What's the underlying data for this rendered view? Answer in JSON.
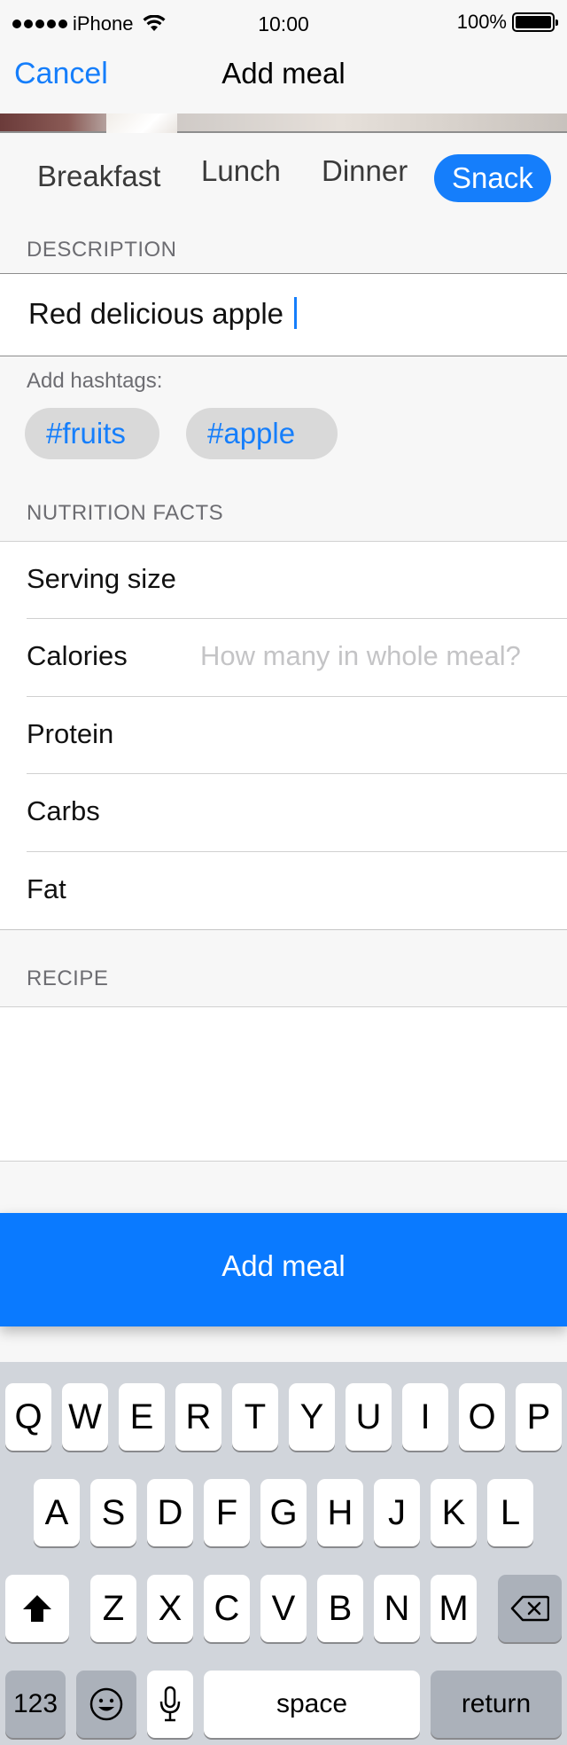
{
  "status_bar": {
    "carrier": "iPhone",
    "time": "10:00",
    "battery": "100%"
  },
  "nav": {
    "cancel_label": "Cancel",
    "title": "Add meal"
  },
  "meal_types": {
    "items": [
      "Breakfast",
      "Lunch",
      "Dinner",
      "Snack"
    ],
    "selected": "Snack"
  },
  "description": {
    "header": "DESCRIPTION",
    "value": "Red delicious apple"
  },
  "hashtags": {
    "label": "Add hashtags:",
    "items": [
      "#fruits",
      "#apple"
    ]
  },
  "nutrition": {
    "header": "NUTRITION FACTS",
    "rows": [
      {
        "label": "Serving size",
        "placeholder": ""
      },
      {
        "label": "Calories",
        "placeholder": "How many in whole meal?"
      },
      {
        "label": "Protein",
        "placeholder": ""
      },
      {
        "label": "Carbs",
        "placeholder": ""
      },
      {
        "label": "Fat",
        "placeholder": ""
      }
    ]
  },
  "recipe": {
    "header": "RECIPE"
  },
  "add_button_label": "Add meal",
  "keyboard": {
    "row1": [
      "Q",
      "W",
      "E",
      "R",
      "T",
      "Y",
      "U",
      "I",
      "O",
      "P"
    ],
    "row2": [
      "A",
      "S",
      "D",
      "F",
      "G",
      "H",
      "J",
      "K",
      "L"
    ],
    "row3": [
      "Z",
      "X",
      "C",
      "V",
      "B",
      "N",
      "M"
    ],
    "numbers_label": "123",
    "space_label": "space",
    "return_label": "return"
  },
  "colors": {
    "accent": "#157efb",
    "button": "#0a7aff",
    "keyboard_bg": "#d1d5db"
  }
}
